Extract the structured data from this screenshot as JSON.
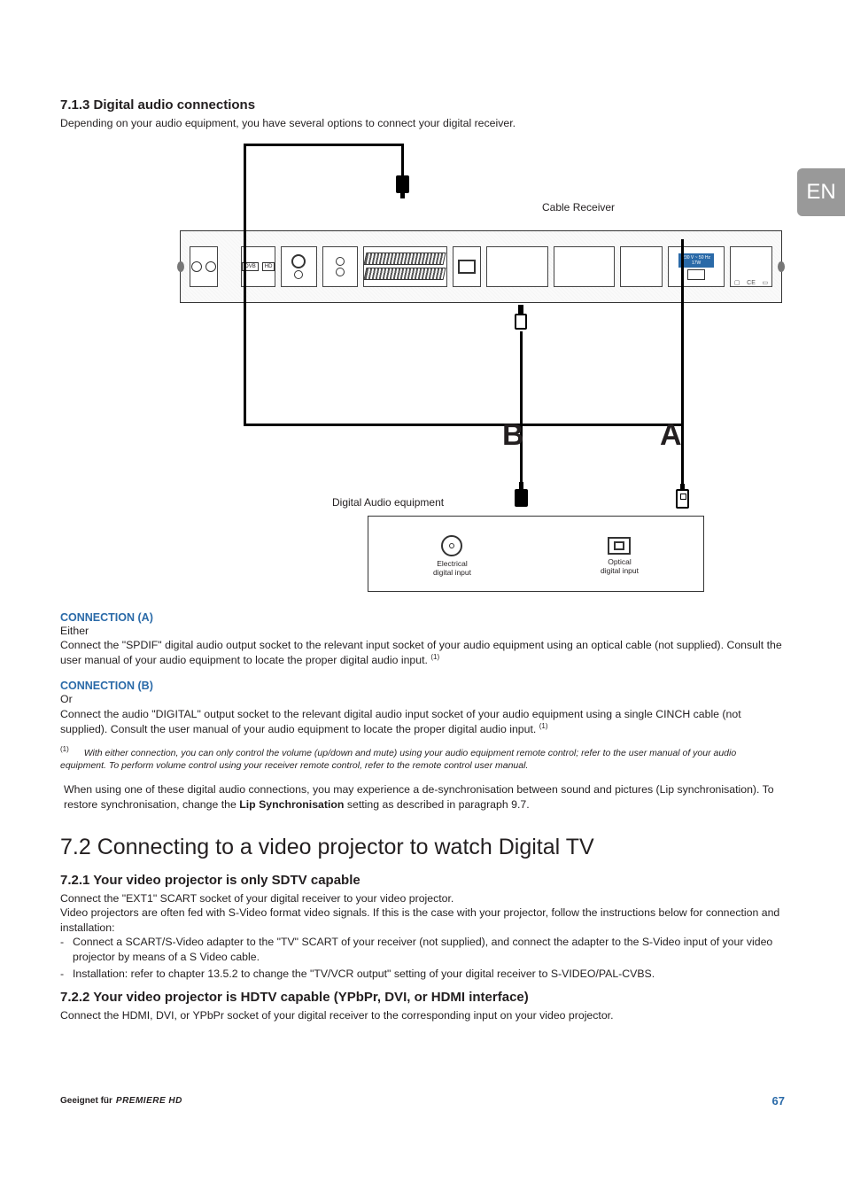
{
  "lang_tab": "EN",
  "s713": {
    "heading": "7.1.3   Digital audio connections",
    "intro": "Depending on your audio equipment, you have several options to connect your digital receiver."
  },
  "diagram": {
    "cable_receiver": "Cable Receiver",
    "letter_a": "A",
    "letter_b": "B",
    "dae_label": "Digital Audio equipment",
    "port_elec_line1": "Electrical",
    "port_elec_line2": "digital input",
    "port_opt_line1": "Optical",
    "port_opt_line2": "digital input"
  },
  "conn_a": {
    "head": "CONNECTION (A)",
    "either": "Either",
    "text": "Connect the \"SPDIF\" digital audio output socket to the relevant input socket of your audio equipment using an optical cable (not supplied). Consult the user manual of your audio equipment to locate the proper digital audio input. ",
    "sup": "(1)"
  },
  "conn_b": {
    "head": "CONNECTION (B)",
    "or": "Or",
    "text": "Connect the audio \"DIGITAL\" output socket to the relevant digital audio input socket of your audio equipment using a single CINCH cable (not supplied). Consult the user manual of your audio equipment to locate the proper digital audio input. ",
    "sup": "(1)"
  },
  "footnote": {
    "num": "(1)",
    "text": "With either connection, you can only control the volume (up/down and mute) using your audio equipment remote control; refer to the user manual of your audio equipment. To perform volume control using your receiver remote control, refer to the remote control user manual."
  },
  "note": {
    "line1": "When using one of these digital audio connections, you may experience a de-synchronisation between sound and pictures (Lip synchronisation). To restore synchronisation, change the ",
    "bold": "Lip Synchronisation",
    "line2": " setting as described in paragraph 9.7."
  },
  "s72": {
    "heading": "7.2   Connecting to a video projector to watch Digital TV"
  },
  "s721": {
    "heading": "7.2.1   Your video projector is only SDTV capable",
    "p1": "Connect the \"EXT1\" SCART socket of your digital receiver to your video projector.",
    "p2": "Video projectors are often fed with S-Video format video signals. If this is the case with your projector, follow the instructions below for connection and installation:",
    "li1": "Connect a SCART/S-Video adapter to the \"TV\" SCART of your receiver (not supplied), and connect the adapter to the S-Video input of your video projector by means of a S Video cable.",
    "li2": "Installation: refer to chapter 13.5.2 to change the \"TV/VCR output\" setting of your digital receiver to S-VIDEO/PAL-CVBS."
  },
  "s722": {
    "heading": "7.2.2   Your video projector is HDTV capable (YPbPr, DVI, or HDMI interface)",
    "p1": "Connect the HDMI, DVI, or YPbPr socket of your digital receiver to the corresponding input on your video projector."
  },
  "footer": {
    "left_pre": "Geeignet für ",
    "brand": "PREMIERE HD",
    "page": "67"
  }
}
